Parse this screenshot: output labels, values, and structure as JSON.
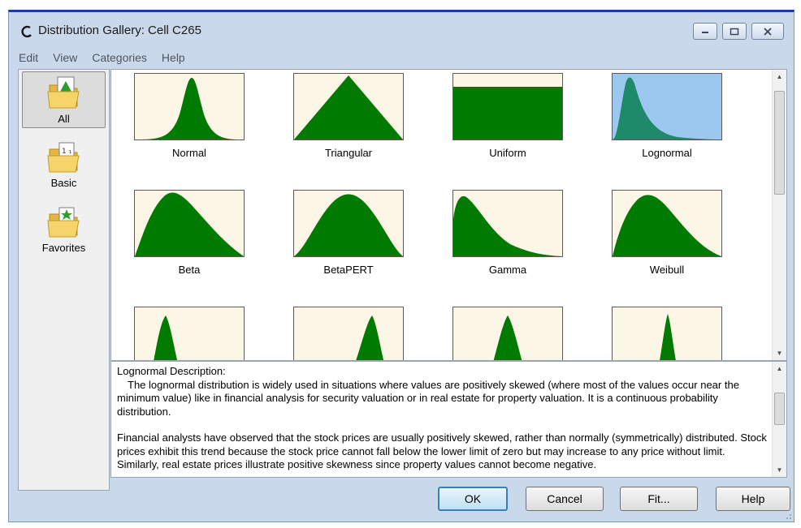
{
  "window": {
    "title": "Distribution Gallery: Cell C265",
    "controls": {
      "minimize": "minimize-icon",
      "maximize": "maximize-icon",
      "close": "close-icon"
    }
  },
  "menu": [
    "Edit",
    "View",
    "Categories",
    "Help"
  ],
  "categories": [
    {
      "label": "All",
      "icon": "folder-chart-icon",
      "selected": true
    },
    {
      "label": "Basic",
      "icon": "folder-basic-icon",
      "selected": false
    },
    {
      "label": "Favorites",
      "icon": "folder-star-icon",
      "selected": false
    }
  ],
  "distributions": [
    {
      "label": "Normal",
      "selected": false
    },
    {
      "label": "Triangular",
      "selected": false
    },
    {
      "label": "Uniform",
      "selected": false
    },
    {
      "label": "Lognormal",
      "selected": true
    },
    {
      "label": "Beta",
      "selected": false
    },
    {
      "label": "BetaPERT",
      "selected": false
    },
    {
      "label": "Gamma",
      "selected": false
    },
    {
      "label": "Weibull",
      "selected": false
    }
  ],
  "description": {
    "heading": "Lognormal Description:",
    "paragraph1": "The lognormal distribution is widely used in situations where values are positively skewed (where most of the values occur near the minimum value) like in financial analysis for security valuation or in real estate for property valuation. It is a continuous probability distribution.",
    "paragraph2": "Financial analysts have observed that the stock prices are usually positively skewed, rather than normally (symmetrically) distributed. Stock prices exhibit this trend because the stock price cannot fall below the lower limit of zero but may increase to any price without limit. Similarly, real estate prices illustrate positive skewness since property values cannot become negative."
  },
  "buttons": {
    "ok": "OK",
    "cancel": "Cancel",
    "fit": "Fit...",
    "help": "Help"
  },
  "colors": {
    "curve_fill": "#007a00",
    "selected_curve_fill": "#1f8a6a",
    "thumb_bg": "#fcf6e7",
    "selected_bg": "#9cc7ee"
  }
}
